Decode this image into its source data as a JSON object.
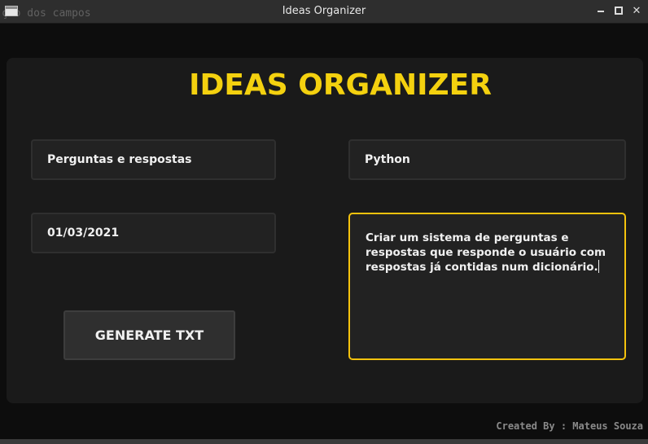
{
  "window": {
    "title": "Ideas Organizer",
    "background_text": "ção dos campos"
  },
  "app": {
    "heading": "IDEAS ORGANIZER",
    "accent_color": "#f4d10f"
  },
  "form": {
    "topic_value": "Perguntas e respostas",
    "language_value": "Python",
    "date_value": "01/03/2021",
    "description_value": "Criar um sistema de  perguntas e respostas que responde o usuário com respostas já contidas num dicionário."
  },
  "actions": {
    "generate_label": "GENERATE TXT"
  },
  "footer": {
    "credit": "Created By : Mateus Souza"
  },
  "icons": {
    "app": "window-icon",
    "minimize": "minimize-icon",
    "maximize": "maximize-icon",
    "close": "close-icon"
  }
}
